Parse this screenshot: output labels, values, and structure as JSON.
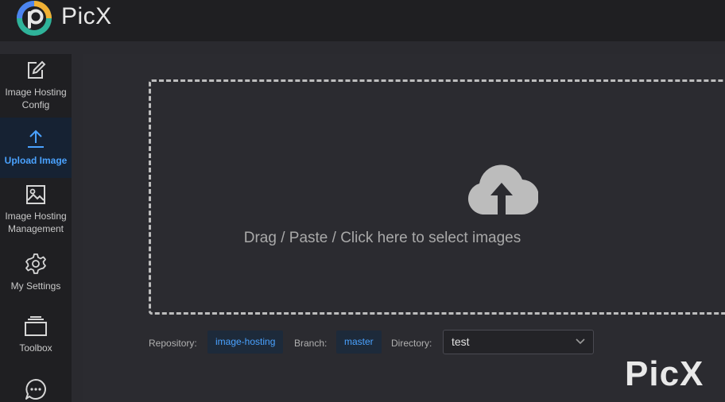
{
  "app": {
    "title": "PicX"
  },
  "sidebar": {
    "items": [
      {
        "label": "Image Hosting Config",
        "icon": "edit-icon"
      },
      {
        "label": "Upload Image",
        "icon": "upload-icon",
        "active": true
      },
      {
        "label": "Image Hosting Management",
        "icon": "image-icon"
      },
      {
        "label": "My Settings",
        "icon": "gear-icon"
      },
      {
        "label": "Toolbox",
        "icon": "toolbox-icon"
      },
      {
        "label": "",
        "icon": "chat-icon"
      }
    ]
  },
  "upload": {
    "dropzone_text": "Drag / Paste / Click here to select images",
    "repository_label": "Repository:",
    "repository_value": "image-hosting",
    "branch_label": "Branch:",
    "branch_value": "master",
    "directory_label": "Directory:",
    "directory_value": "test"
  },
  "watermark": "PicX",
  "colors": {
    "accent": "#4aa2ff",
    "background": "#2a2a2f",
    "sidebar": "#1f1f22"
  }
}
